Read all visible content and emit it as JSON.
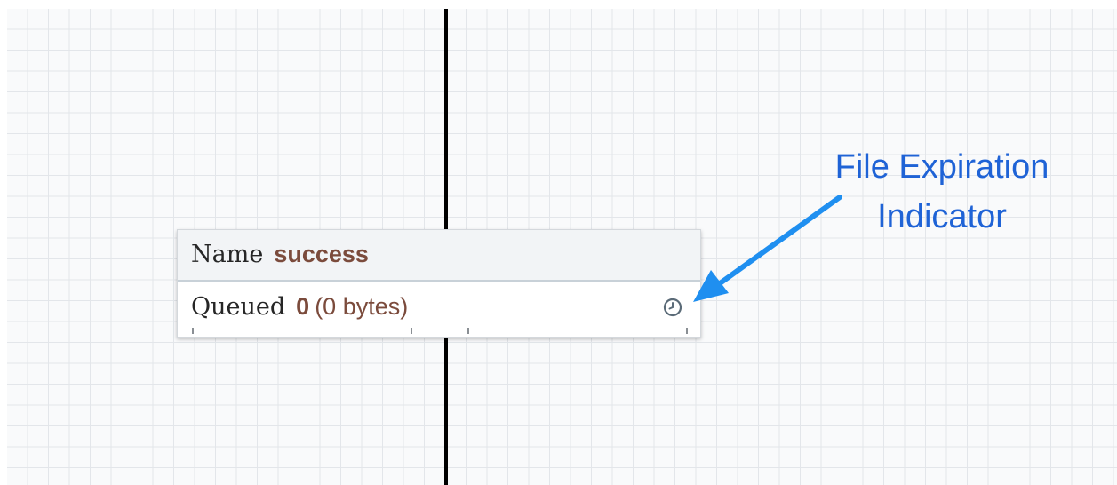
{
  "connection_label": {
    "name_label": "Name",
    "name_value": "success",
    "queued_label": "Queued",
    "queued_count": "0",
    "queued_size": "(0 bytes)",
    "expiration_icon": "clock-icon"
  },
  "annotation": {
    "line1": "File Expiration",
    "line2": "Indicator",
    "color": "#1f63d6"
  },
  "colors": {
    "connection_line": "#000000",
    "value_text": "#7b4b3c",
    "grid": "#e3e6ea"
  }
}
